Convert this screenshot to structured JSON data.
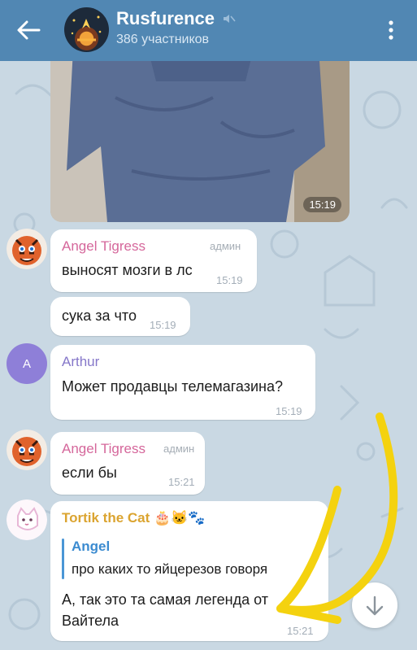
{
  "header": {
    "title": "Rusfurence",
    "subtitle": "386 участников"
  },
  "photo": {
    "time": "15:19"
  },
  "messages": [
    {
      "sender": "Angel Tigress",
      "role": "админ",
      "text": "выносят мозги в лс",
      "time": "15:19"
    },
    {
      "text": "сука за что",
      "time": "15:19"
    },
    {
      "sender": "Arthur",
      "avatar_letter": "A",
      "text": "Может продавцы телемагазина?",
      "time": "15:19"
    },
    {
      "sender": "Angel Tigress",
      "role": "админ",
      "text": "если бы",
      "time": "15:21"
    },
    {
      "sender": "Tortik the Cat 🎂🐱🐾",
      "reply": {
        "name": "Angel",
        "text": "про каких то яйцерезов говоря"
      },
      "text_line1": "А, так это та самая легенда от",
      "text_line2": "Вайтела",
      "time": "15:21"
    }
  ],
  "colors": {
    "header": "#5187b3",
    "background": "#c9d8e3",
    "angel_name": "#d5679b",
    "arthur_name": "#8577c9",
    "tortik_name": "#dba430",
    "reply_accent": "#3b8bd0",
    "annotation_arrow": "#f4d20f"
  }
}
